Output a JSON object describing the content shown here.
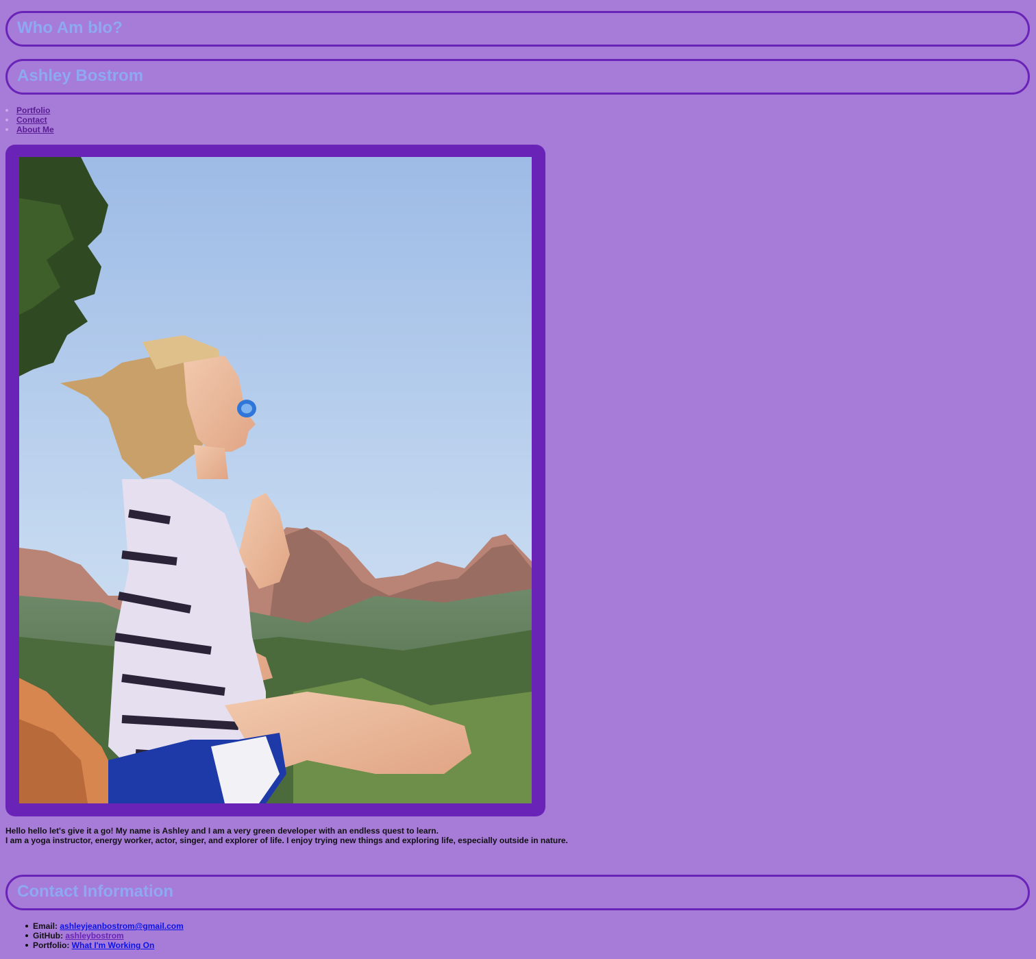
{
  "header": {
    "site_title": "Who Am bIo?",
    "name": "Ashley Bostrom"
  },
  "nav": {
    "items": [
      {
        "label": "Portfolio"
      },
      {
        "label": "Contact"
      },
      {
        "label": "About Me"
      }
    ]
  },
  "profile_photo": {
    "subject": "woman meditating with hands in prayer pose on a mountain overlook"
  },
  "bio": {
    "line1": "Hello hello let's give it a go! My name is Ashley and I am a very green developer with an endless quest to learn.",
    "line2": "I am a yoga instructor, energy worker, actor, singer, and explorer of life. I enjoy trying new things and exploring life, especially outside in nature."
  },
  "contact": {
    "heading": "Contact Information",
    "items": [
      {
        "label": "Email: ",
        "link_text": "ashleyjeanbostrom@gmail.com"
      },
      {
        "label": "GitHub: ",
        "link_text": "ashleybostrom"
      },
      {
        "label": "Portfolio: ",
        "link_text": "What I'm Working On"
      }
    ]
  },
  "colors": {
    "background": "#a77bd8",
    "accent": "#6a23b7",
    "heading_text": "#8fa8f2",
    "link": "#0b14e8"
  }
}
